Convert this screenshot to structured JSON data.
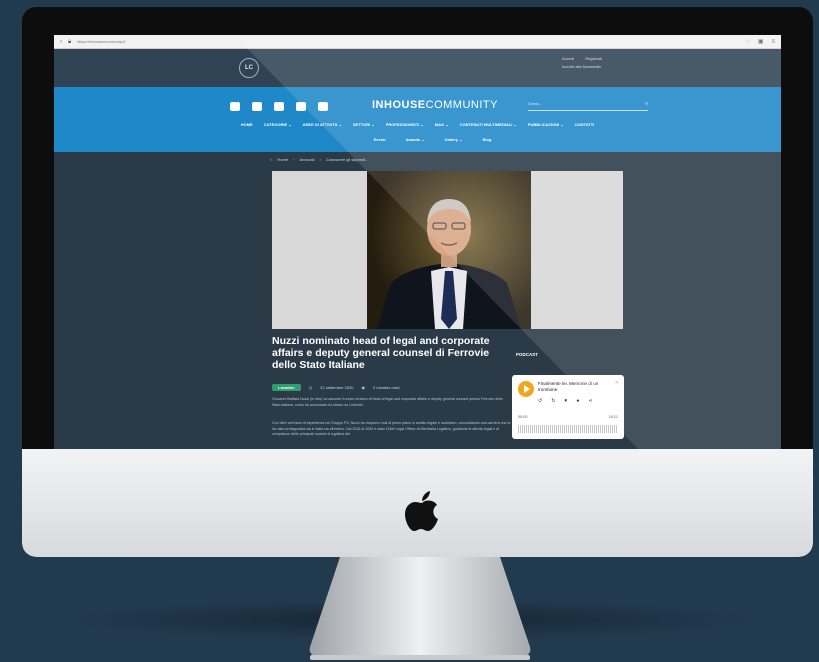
{
  "browser": {
    "url": "https://inhousecommunity.it",
    "icons": [
      "back-icon",
      "lock-icon",
      "shield-icon",
      "extensions-icon",
      "menu-icon"
    ]
  },
  "site": {
    "logo_text": "LC",
    "top_links": [
      "Accedi",
      "Registrati",
      "Iscriviti alla Newsletter"
    ],
    "brand_bold": "INHOUSE",
    "brand_light": "COMMUNITY",
    "search_placeholder": "Cerca...",
    "social_icons": [
      "linkedin-icon",
      "twitter-icon",
      "youtube-icon",
      "instagram-icon",
      "facebook-icon"
    ],
    "menu_primary": [
      "HOME",
      "CATEGORIE ⌄",
      "AREE DI ATTIVITÀ ⌄",
      "SETTORI ⌄",
      "PROFESSIONISTI ⌄",
      "MAG ⌄",
      "CONTENUTI MULTIMEDIALI ⌄",
      "PUBBLICAZIONI ⌄",
      "CONTATTI"
    ],
    "menu_secondary": [
      "Eventi",
      "Awards ⌄",
      "Gallery ⌄",
      "Blog"
    ]
  },
  "breadcrumb": [
    "Home",
    "Avvocati",
    "Conoscere gli stipendi..."
  ],
  "article": {
    "title": "Nuzzi nominato head of legal and corporate affairs e deputy general counsel di Ferrovie dello Stato Italiane",
    "badge": "Location",
    "date": "22 settembre 2020",
    "read_time": "2 minutes read",
    "paragraphs": [
      "Giovanni Battista Nuzzi (in foto) ha assunto il nuovo incarico di head of legal and corporate affairs e deputy general counsel presso Ferrovie dello Stato Italiane, come ha annunciato lui stesso su LinkedIn.",
      "Con oltre vent'anni di esperienza nel Gruppo FS, Nuzzi ha ricoperto ruoli di primo piano in ambito legale e societario, consolidando una carriera che lo ha visto protagonista sia in Italia sia all'estero. Dal 2016 al 2020 è stato Chief Legal Officer di Mercitalia Logistics, guidando le attività legali e di compliance delle principali società di logistica del"
    ]
  },
  "sidebar": {
    "podcast_label": "PODCAST",
    "episode_title": "Finalmente lei. Memorie di un trombone",
    "time_start": "00:00",
    "time_end": "18:21",
    "player_controls": [
      "replay-icon",
      "forward-icon",
      "heart-icon",
      "comment-icon",
      "share-icon"
    ]
  }
}
